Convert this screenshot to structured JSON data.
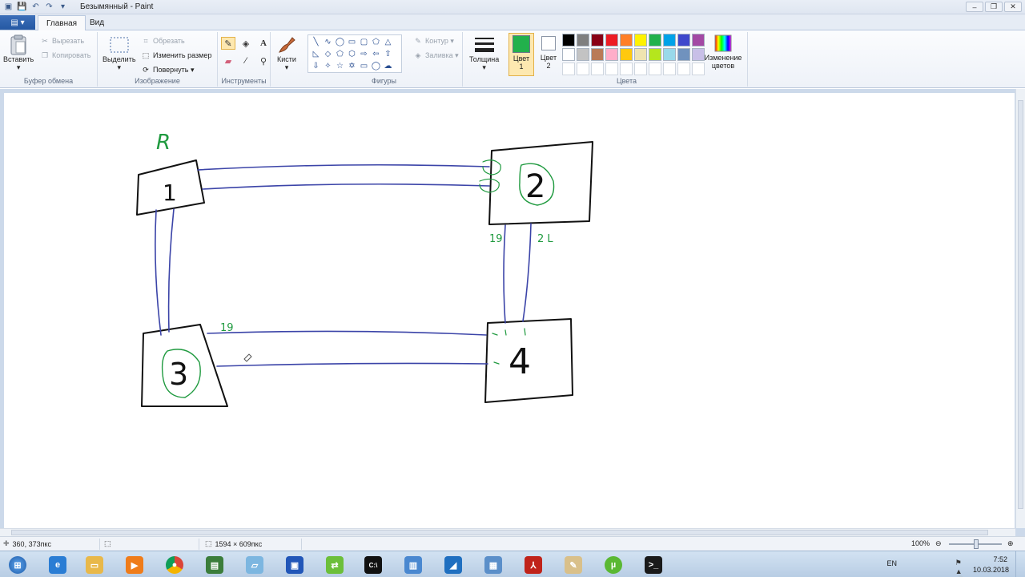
{
  "window": {
    "title": "Безымянный - Paint",
    "minimize": "–",
    "maximize": "❐",
    "close": "✕"
  },
  "ribbon_tabs": {
    "menu": "▤ ▾",
    "home": "Главная",
    "view": "Вид"
  },
  "clipboard": {
    "paste": "Вставить",
    "cut": "Вырезать",
    "copy": "Копировать",
    "label": "Буфер обмена"
  },
  "image": {
    "select": "Выделить",
    "crop": "Обрезать",
    "resize": "Изменить размер",
    "rotate": "Повернуть ▾",
    "label": "Изображение"
  },
  "tools": {
    "label": "Инструменты"
  },
  "brushes": {
    "label": "Кисти"
  },
  "shapes": {
    "outline": "Контур ▾",
    "fill": "Заливка ▾",
    "label": "Фигуры"
  },
  "size": {
    "label": "Толщина"
  },
  "colors": {
    "color1": "Цвет 1",
    "color2": "Цвет 2",
    "edit": "Изменение цветов",
    "label": "Цвета",
    "color1_value": "#22b14c",
    "color2_value": "#ffffff",
    "palette": [
      "#000000",
      "#7f7f7f",
      "#880015",
      "#ed1c24",
      "#ff7f27",
      "#fff200",
      "#22b14c",
      "#00a2e8",
      "#3f48cc",
      "#a349a4",
      "#ffffff",
      "#c3c3c3",
      "#b97a57",
      "#ffaec9",
      "#ffc90e",
      "#efe4b0",
      "#b5e61d",
      "#99d9ea",
      "#7092be",
      "#c8bfe7",
      "#ffffff",
      "#ffffff",
      "#ffffff",
      "#ffffff",
      "#ffffff",
      "#ffffff",
      "#ffffff",
      "#ffffff",
      "#ffffff",
      "#ffffff"
    ]
  },
  "drawing": {
    "r_label": "R",
    "node1": "1",
    "node2": "2",
    "node3": "3",
    "node4": "4",
    "port_2_left": "19",
    "port_2_right": "2 L",
    "port_3_top": "19",
    "stroke_blue": "#3b44a8",
    "stroke_green": "#1f9a3f"
  },
  "status": {
    "cursor_pos": "360, 373пкс",
    "image_size": "1594 × 609пкс",
    "zoom": "100%"
  },
  "tray": {
    "lang": "EN",
    "time": "7:52",
    "date": "10.03.2018"
  }
}
